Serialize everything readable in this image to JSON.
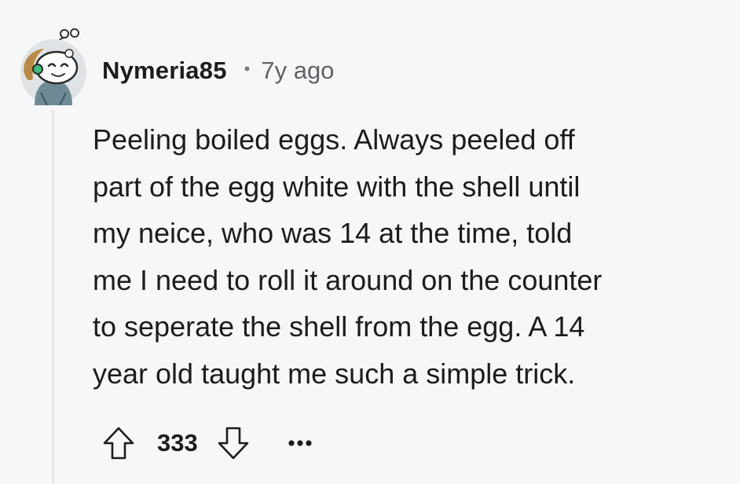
{
  "comment": {
    "author": {
      "username": "Nymeria85",
      "avatar_icon": "snoo-avatar-icon"
    },
    "separator": "•",
    "timestamp": "7y ago",
    "body": "Peeling boiled eggs. Always peeled off\npart of the egg white with the shell until\nmy neice, who was 14 at the time, told\nme I need to roll it around on the counter\nto seperate the shell from the egg. A 14\nyear old taught me such a simple trick.",
    "score": "333",
    "more_label": "•••"
  },
  "icons": {
    "upvote": "arrow-up-icon",
    "downvote": "arrow-down-icon",
    "more": "more-horizontal-icon"
  },
  "colors": {
    "background": "#f6f7f8",
    "thread_line": "#e3e5e8",
    "text": "#1c1c1c",
    "muted": "#5f6266"
  }
}
